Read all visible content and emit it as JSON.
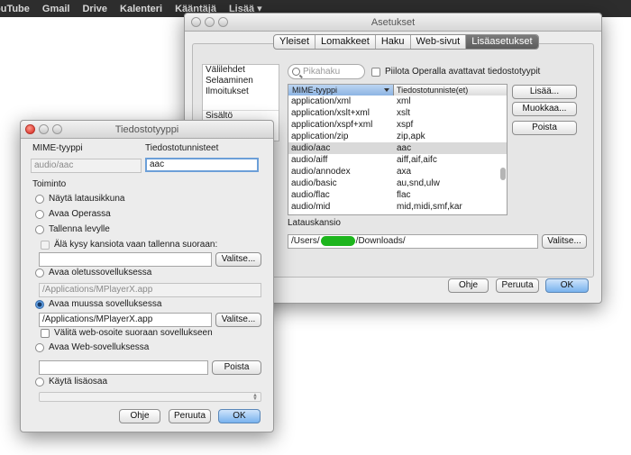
{
  "gbar": {
    "links": [
      "ouTube",
      "Gmail",
      "Drive",
      "Kalenteri",
      "Kääntäjä",
      "Lisää ▾"
    ]
  },
  "settings": {
    "title": "Asetukset",
    "tabs": [
      "Yleiset",
      "Lomakkeet",
      "Haku",
      "Web-sivut",
      "Lisäasetukset"
    ],
    "active_tab": "Lisäasetukset",
    "sidebar_items": [
      "Välilehdet",
      "Selaaminen",
      "Ilmoitukset",
      "Sisältö"
    ],
    "search_placeholder": "Pikahaku",
    "hide_checkbox_label": "Piilota Operalla avattavat tiedostotyypit",
    "table": {
      "headers": [
        "MIME-tyyppi",
        "Tiedostotunniste(et)"
      ],
      "rows": [
        {
          "mime": "application/xml",
          "ext": "xml"
        },
        {
          "mime": "application/xslt+xml",
          "ext": "xslt"
        },
        {
          "mime": "application/xspf+xml",
          "ext": "xspf"
        },
        {
          "mime": "application/zip",
          "ext": "zip,apk"
        },
        {
          "mime": "audio/aac",
          "ext": "aac"
        },
        {
          "mime": "audio/aiff",
          "ext": "aiff,aif,aifc"
        },
        {
          "mime": "audio/annodex",
          "ext": "axa"
        },
        {
          "mime": "audio/basic",
          "ext": "au,snd,ulw"
        },
        {
          "mime": "audio/flac",
          "ext": "flac"
        },
        {
          "mime": "audio/mid",
          "ext": "mid,midi,smf,kar"
        }
      ],
      "selected": "audio/aac"
    },
    "buttons": {
      "add": "Lisää...",
      "edit": "Muokkaa...",
      "delete": "Poista"
    },
    "download_label": "Latauskansio",
    "download_path_start": "/Users/",
    "download_path_end": "/Downloads/",
    "browse": "Valitse...",
    "help": "Ohje",
    "cancel": "Peruuta",
    "ok": "OK"
  },
  "filetype": {
    "title": "Tiedostotyyppi",
    "mime_label": "MIME-tyyppi",
    "ext_label": "Tiedostotunnisteet",
    "mime_value": "audio/aac",
    "ext_value": "aac",
    "action_label": "Toiminto",
    "options": {
      "show_dialog": "Näytä latausikkuna",
      "open_in_opera": "Avaa Operassa",
      "save_to_disk": "Tallenna levylle",
      "dont_ask": "Älä kysy kansiota vaan tallenna suoraan:",
      "open_default": "Avaa oletussovelluksessa",
      "default_path": "/Applications/MPlayerX.app",
      "open_other": "Avaa muussa sovelluksessa",
      "other_path": "/Applications/MPlayerX.app",
      "pass_url": "Välitä web-osoite suoraan sovellukseen",
      "open_web_app": "Avaa Web-sovelluksessa",
      "use_plugin": "Käytä lisäosaa"
    },
    "browse": "Valitse...",
    "delete": "Poista",
    "help": "Ohje",
    "cancel": "Peruuta",
    "ok": "OK"
  }
}
